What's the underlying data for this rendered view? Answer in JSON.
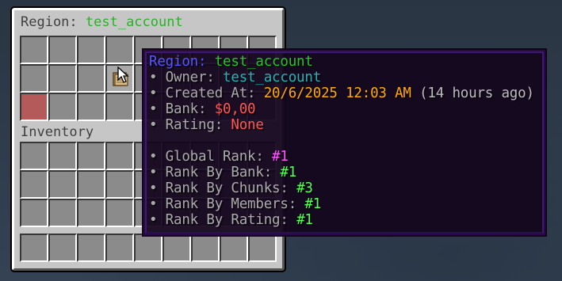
{
  "container": {
    "title_prefix": "Region: ",
    "title_name": "test_account",
    "inventory_label": "Inventory"
  },
  "tooltip": {
    "header_label": "Region: ",
    "header_name": "test_account",
    "bullet": "•",
    "owner_label": " Owner: ",
    "owner_value": "test_account",
    "created_label": " Created At: ",
    "created_value": "20/6/2025 12:03 AM",
    "created_relative": " (14 hours ago)",
    "bank_label": " Bank: ",
    "bank_value": "$0,00",
    "rating_label": " Rating: ",
    "rating_value": "None",
    "global_rank_label": " Global Rank: ",
    "global_rank_value": "#1",
    "rank_bank_label": " Rank By Bank: ",
    "rank_bank_value": "#1",
    "rank_chunks_label": " Rank By Chunks: ",
    "rank_chunks_value": "#3",
    "rank_members_label": " Rank By Members: ",
    "rank_members_value": "#1",
    "rank_rating_label": " Rank By Rating: ",
    "rank_rating_value": "#1"
  },
  "colors": {
    "panel": "#c6c6c6",
    "slot": "#8b8b8b",
    "red_slot": "#b55a5a",
    "tooltip_bg": "#14061e",
    "accent_green": "#27b327",
    "blue": "#5555ff",
    "aqua": "#1fb5b5",
    "gold": "#ffaa00",
    "red": "#ff5555",
    "pink": "#ff55ff",
    "lime": "#55ff55"
  },
  "icons": {
    "hovered_item": "scroll-map-icon",
    "cursor": "mouse-pointer-icon"
  }
}
